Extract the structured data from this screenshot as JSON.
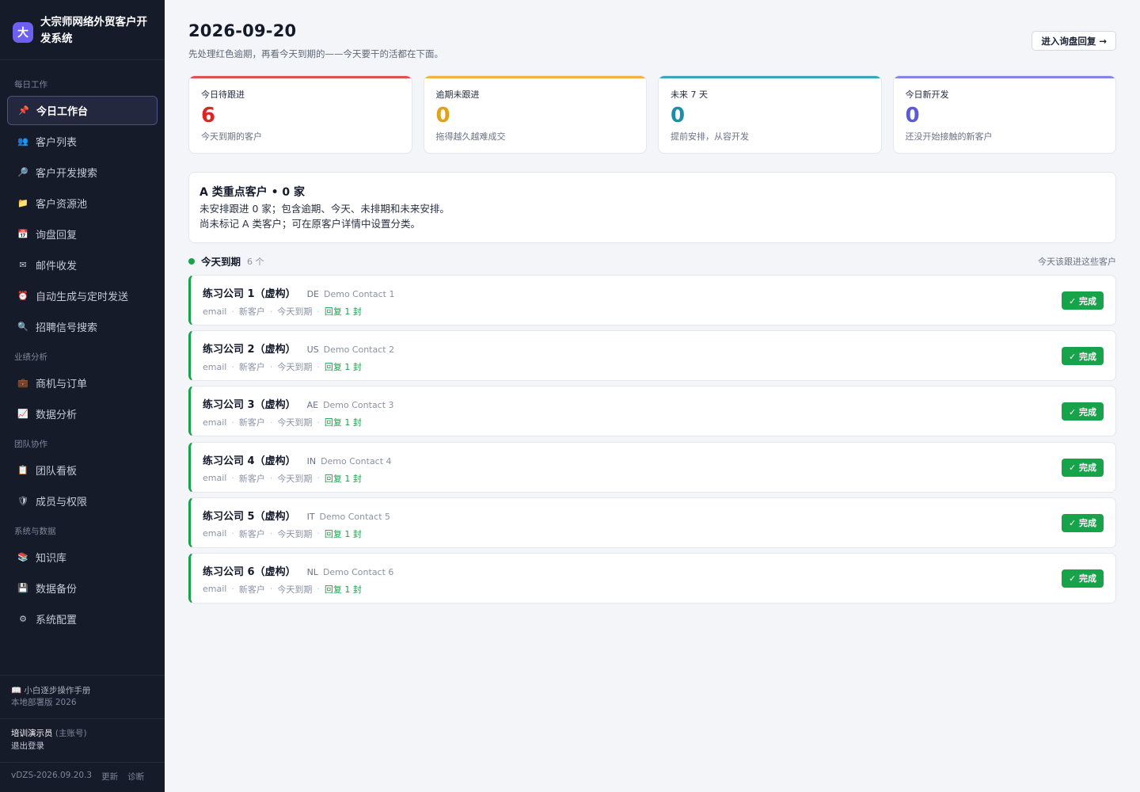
{
  "app": {
    "logo_char": "大",
    "title": "大宗师网络外贸客户开发系统"
  },
  "nav": {
    "sections": [
      {
        "label": "每日工作",
        "items": [
          {
            "label": "今日工作台",
            "icon": "pin-icon",
            "active": true
          },
          {
            "label": "客户列表",
            "icon": "people-icon"
          },
          {
            "label": "客户开发搜索",
            "icon": "magnifier-icon"
          },
          {
            "label": "客户资源池",
            "icon": "folder-icon"
          },
          {
            "label": "询盘回复",
            "icon": "calendar-icon"
          },
          {
            "label": "邮件收发",
            "icon": "envelope-icon"
          },
          {
            "label": "自动生成与定时发送",
            "icon": "alarm-clock-icon"
          },
          {
            "label": "招聘信号搜索",
            "icon": "search-icon"
          }
        ]
      },
      {
        "label": "业绩分析",
        "items": [
          {
            "label": "商机与订单",
            "icon": "briefcase-icon"
          },
          {
            "label": "数据分析",
            "icon": "chart-icon"
          }
        ]
      },
      {
        "label": "团队协作",
        "items": [
          {
            "label": "团队看板",
            "icon": "clipboard-icon"
          },
          {
            "label": "成员与权限",
            "icon": "shield-icon"
          }
        ]
      },
      {
        "label": "系统与数据",
        "items": [
          {
            "label": "知识库",
            "icon": "books-icon"
          },
          {
            "label": "数据备份",
            "icon": "floppy-icon"
          },
          {
            "label": "系统配置",
            "icon": "gear-icon"
          }
        ]
      }
    ]
  },
  "footer": {
    "manual_label": "小白逐步操作手册",
    "deploy_label": "本地部署版 2026",
    "user_name": "培训演示员",
    "user_role": "(主账号)",
    "logout_label": "退出登录",
    "version": "vDZS-2026.09.20.3",
    "update_label": "更新",
    "diagnose_label": "诊断"
  },
  "header": {
    "date": "2026-09-20",
    "subtitle": "先处理红色逾期，再看今天到期的——今天要干的活都在下面。",
    "inquiry_button": "进入询盘回复 →"
  },
  "stats": [
    {
      "label": "今日待跟进",
      "value": "6",
      "desc": "今天到期的客户",
      "color": "#dc2626",
      "bar": "#e05252"
    },
    {
      "label": "逾期未跟进",
      "value": "0",
      "desc": "拖得越久越难成交",
      "color": "#e0a11b",
      "bar": "#f0b43c"
    },
    {
      "label": "未来 7 天",
      "value": "0",
      "desc": "提前安排，从容开发",
      "color": "#1c8ea6",
      "bar": "#3aa6b9"
    },
    {
      "label": "今日新开发",
      "value": "0",
      "desc": "还没开始接触的新客户",
      "color": "#5b5bd6",
      "bar": "#8784e8"
    }
  ],
  "a_clients": {
    "title": "A 类重点客户 • 0 家",
    "line1": "未安排跟进 0 家；包含逾期、今天、未排期和未来安排。",
    "line2": "尚未标记 A 类客户；可在原客户详情中设置分类。"
  },
  "due_today": {
    "title": "今天到期",
    "count": "6 个",
    "hint": "今天该跟进这些客户",
    "done_label": "✓ 完成",
    "rows": [
      {
        "company": "练习公司 1（虚构）",
        "country": "DE",
        "contact": "Demo Contact 1",
        "channel": "email",
        "status": "新客户",
        "due": "今天到期",
        "reply": "回复 1 封"
      },
      {
        "company": "练习公司 2（虚构）",
        "country": "US",
        "contact": "Demo Contact 2",
        "channel": "email",
        "status": "新客户",
        "due": "今天到期",
        "reply": "回复 1 封"
      },
      {
        "company": "练习公司 3（虚构）",
        "country": "AE",
        "contact": "Demo Contact 3",
        "channel": "email",
        "status": "新客户",
        "due": "今天到期",
        "reply": "回复 1 封"
      },
      {
        "company": "练习公司 4（虚构）",
        "country": "IN",
        "contact": "Demo Contact 4",
        "channel": "email",
        "status": "新客户",
        "due": "今天到期",
        "reply": "回复 1 封"
      },
      {
        "company": "练习公司 5（虚构）",
        "country": "IT",
        "contact": "Demo Contact 5",
        "channel": "email",
        "status": "新客户",
        "due": "今天到期",
        "reply": "回复 1 封"
      },
      {
        "company": "练习公司 6（虚构）",
        "country": "NL",
        "contact": "Demo Contact 6",
        "channel": "email",
        "status": "新客户",
        "due": "今天到期",
        "reply": "回复 1 封"
      }
    ]
  }
}
